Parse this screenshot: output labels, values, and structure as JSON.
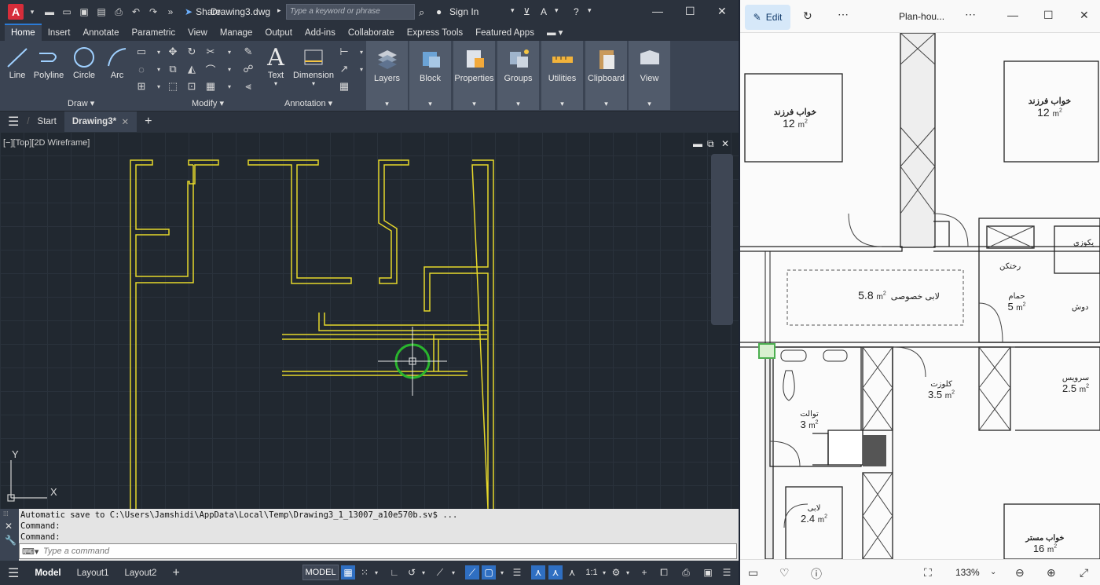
{
  "acad": {
    "share": "Share",
    "filename": "Drawing3.dwg",
    "search_placeholder": "Type a keyword or phrase",
    "signin": "Sign In",
    "tabs": [
      "Home",
      "Insert",
      "Annotate",
      "Parametric",
      "View",
      "Manage",
      "Output",
      "Add-ins",
      "Collaborate",
      "Express Tools",
      "Featured Apps"
    ],
    "draw_tools": [
      "Line",
      "Polyline",
      "Circle",
      "Arc"
    ],
    "annotation_tools": [
      "Text",
      "Dimension"
    ],
    "panels": [
      "Layers",
      "Block",
      "Properties",
      "Groups",
      "Utilities",
      "Clipboard",
      "View"
    ],
    "panel_names": {
      "draw": "Draw",
      "modify": "Modify",
      "annotation": "Annotation"
    },
    "file_tabs": {
      "start": "Start",
      "drawing": "Drawing3*"
    },
    "viewport_label": "[−][Top][2D Wireframe]",
    "ucs": {
      "x": "X",
      "y": "Y"
    },
    "command_history": [
      "Automatic save to C:\\Users\\Jamshidi\\AppData\\Local\\Temp\\Drawing3_1_13007_a10e570b.sv$ ...",
      "Command:",
      "Command:"
    ],
    "command_placeholder": "Type a command",
    "layout_tabs": {
      "model": "Model",
      "layout1": "Layout1",
      "layout2": "Layout2"
    },
    "status_model": "MODEL",
    "scale": "1:1",
    "colors": {
      "walls": "#e6d72a",
      "cursor_circle": "#29b52d",
      "accent": "#2b7bd6"
    }
  },
  "photos": {
    "edit": "Edit",
    "title": "Plan-hou...",
    "zoom": "133%",
    "rooms": [
      {
        "name": "خواب فرزند",
        "area": "12",
        "unit": "m"
      },
      {
        "name": "خواب فرزند",
        "area": "12",
        "unit": "m"
      },
      {
        "name": "لابی خصوصی",
        "area": "5.8",
        "unit": "m"
      },
      {
        "name": "حمام",
        "area": "5",
        "unit": "m"
      },
      {
        "name": "رختکن",
        "area": "",
        "unit": ""
      },
      {
        "name": "دوش",
        "area": "",
        "unit": ""
      },
      {
        "name": "یکوزی",
        "area": "",
        "unit": ""
      },
      {
        "name": "کلوزت",
        "area": "3.5",
        "unit": "m"
      },
      {
        "name": "سرویس",
        "area": "2.5",
        "unit": "m"
      },
      {
        "name": "توالت",
        "area": "3",
        "unit": "m"
      },
      {
        "name": "لابی",
        "area": "2.4",
        "unit": "m"
      },
      {
        "name": "خواب مستر",
        "area": "16",
        "unit": "m"
      }
    ]
  }
}
